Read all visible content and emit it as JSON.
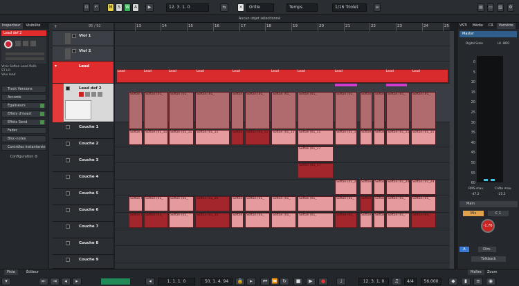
{
  "toolbar": {
    "mode_m": "M",
    "mode_s": "S",
    "mode_w": "W",
    "mode_a": "A",
    "position": "12. 3. 1. 0",
    "grid_label": "Grille",
    "time_label": "Temps",
    "quantize": "1/16 Triolet"
  },
  "status_message": "Aucun objet sélectionné",
  "inspector": {
    "tabs": [
      "Inspecteur",
      "Visibilité"
    ],
    "track_name": "Lead def 2",
    "inserts": [
      "Vtrix Softan Lead Rolls",
      "ST LO",
      "Voix lead"
    ],
    "sections": [
      "Track Versions",
      "Accords",
      "Égaliseurs",
      "Effets d'insert",
      "Effets Send",
      "Fader",
      "Bloc-notes",
      "Contrôles instantanés"
    ],
    "configuration": "Configuration"
  },
  "tracks": [
    {
      "name": "Viol 1"
    },
    {
      "name": "Viol 2"
    },
    {
      "name": "Lead"
    },
    {
      "name": "Lead def 2"
    },
    {
      "name": "Couche 1"
    },
    {
      "name": "Couche 2"
    },
    {
      "name": "Couche 3"
    },
    {
      "name": "Couche 4"
    },
    {
      "name": "Couche 5"
    },
    {
      "name": "Couche 6"
    },
    {
      "name": "Couche 7"
    },
    {
      "name": "Couche 8"
    },
    {
      "name": "Couche 9"
    }
  ],
  "ruler": [
    "13",
    "14",
    "15",
    "16",
    "17",
    "18",
    "19",
    "20",
    "21",
    "22",
    "23",
    "24",
    "25"
  ],
  "ruler_zoom": "95 / 92",
  "lead_clip_label": "Lead",
  "clip_labels": {
    "softan": "Softan (01_",
    "s01_11": "Softan (01_11",
    "s01_17": "Softan (01_17",
    "s01_21": "Softan (01_21",
    "s01_24": "Softan (01_24",
    "s01_26": "Softan (01_26",
    "s01_35": "Softan (01_35"
  },
  "right_panel": {
    "tabs": [
      "VSTi",
      "Média",
      "CR",
      "Vumètre"
    ],
    "master": "Master",
    "meter_title": "Digital Scale",
    "meter_mode": "LU -INFO",
    "scale": [
      "0",
      "5",
      "10",
      "15",
      "20",
      "25",
      "30",
      "35",
      "40",
      "45",
      "50",
      "55",
      "60"
    ],
    "rms_label": "RMS max.",
    "rms_value": "-47.2",
    "peak_label": "Crête max.",
    "peak_value": "-25.5",
    "main": "Main",
    "mix": "Mix",
    "c1": "C 1",
    "knob_value": "-1.76",
    "a_label": "A",
    "dim_label": "Dim.",
    "talkback": "Talkback"
  },
  "bottom_tabs": {
    "left": [
      "Piste",
      "Éditeur"
    ],
    "right": [
      "Maître",
      "Zoom"
    ]
  },
  "transport": {
    "left_locator": "1. 1. 1. 0",
    "right_locator": "50. 1. 4. 94",
    "position": "12. 3. 1. 0",
    "time_sig": "4/4",
    "tempo": "56.000"
  }
}
